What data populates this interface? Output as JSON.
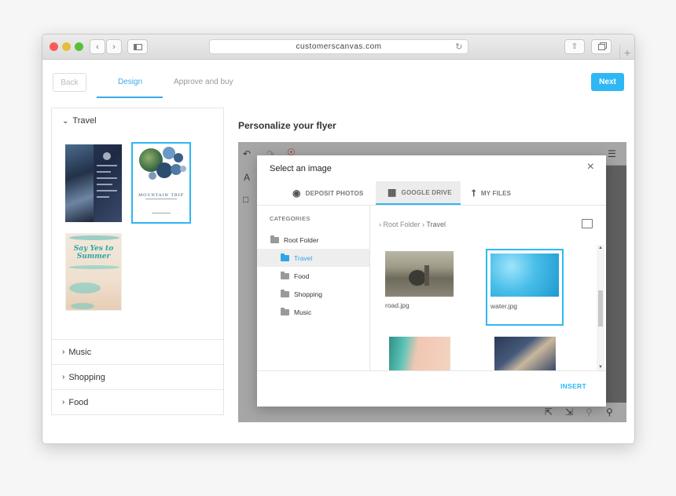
{
  "browser": {
    "url": "customerscanvas.com",
    "back_icon": "chevron-left-icon",
    "forward_icon": "chevron-right-icon",
    "sidebar_icon": "sidebar-icon",
    "reload_icon": "reload-icon",
    "share_icon": "share-icon",
    "tabs_icon": "tabs-icon",
    "new_tab_label": "+"
  },
  "header": {
    "back_label": "Back",
    "steps": [
      {
        "label": "Design",
        "active": true
      },
      {
        "label": "Approve and buy",
        "active": false
      }
    ],
    "next_label": "Next",
    "accent_color": "#2fb7f5"
  },
  "categories_panel": {
    "open_category": "Travel",
    "templates": [
      {
        "name": "dark-travel-flyer"
      },
      {
        "name": "mountain-trip-flyer",
        "title": "MOUNTAIN TRIP",
        "selected": true
      },
      {
        "name": "say-yes-to-summer-flyer",
        "title": "Say Yes to Summer"
      }
    ],
    "collapsed": [
      "Music",
      "Shopping",
      "Food"
    ]
  },
  "editor": {
    "title": "Personalize your flyer"
  },
  "dialog": {
    "title": "Select an image",
    "close_icon": "close-icon",
    "tabs": [
      {
        "label": "DEPOSIT PHOTOS",
        "icon": "camera-icon",
        "active": false
      },
      {
        "label": "GOOGLE DRIVE",
        "icon": "image-icon",
        "active": true
      },
      {
        "label": "MY FILES",
        "icon": "upload-icon",
        "active": false
      }
    ],
    "categories_label": "CATEGORIES",
    "folders": [
      {
        "label": "Root Folder",
        "level": 0,
        "active": false
      },
      {
        "label": "Travel",
        "level": 1,
        "active": true
      },
      {
        "label": "Food",
        "level": 1,
        "active": false
      },
      {
        "label": "Shopping",
        "level": 1,
        "active": false
      },
      {
        "label": "Music",
        "level": 1,
        "active": false
      }
    ],
    "breadcrumb": {
      "root": "Root Folder",
      "current": "Travel"
    },
    "files": [
      {
        "name": "road.jpg",
        "selected": false
      },
      {
        "name": "water.jpg",
        "selected": true
      },
      {
        "name": "",
        "selected": false
      },
      {
        "name": "",
        "selected": false
      }
    ],
    "insert_label": "INSERT"
  }
}
